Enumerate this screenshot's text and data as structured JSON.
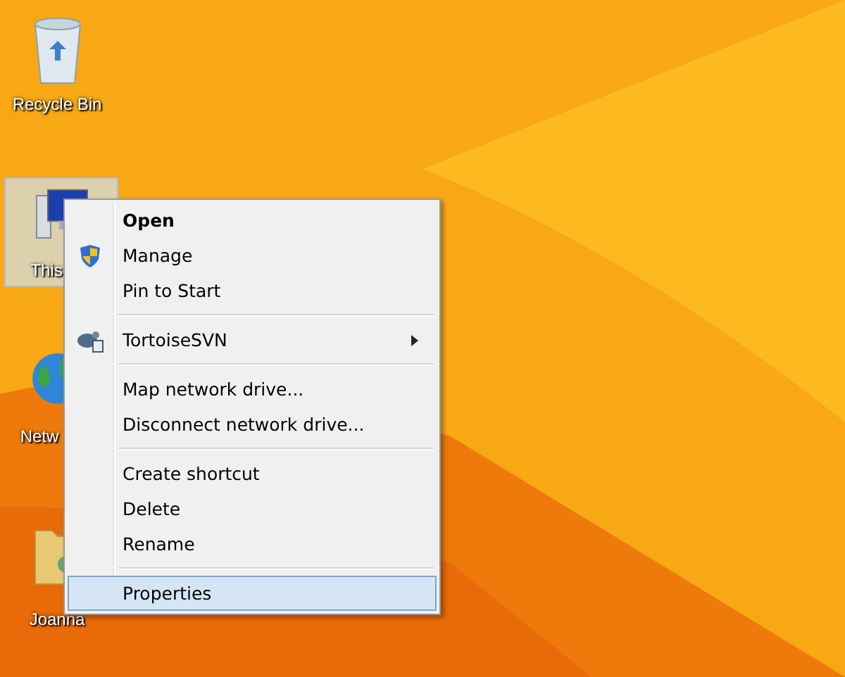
{
  "desktop_icons": [
    {
      "label": "Recycle Bin",
      "kind": "bin",
      "selected": false
    },
    {
      "label": "This",
      "kind": "computer",
      "selected": true
    },
    {
      "label": "Netw",
      "kind": "network",
      "selected": false
    },
    {
      "label": "Joanna",
      "kind": "userfolder",
      "selected": false
    }
  ],
  "context_menu": {
    "items": [
      {
        "kind": "item",
        "label": "Open",
        "default": true,
        "selected": false
      },
      {
        "kind": "item",
        "label": "Manage",
        "default": false,
        "selected": false
      },
      {
        "kind": "item",
        "label": "Pin to Start",
        "default": false,
        "selected": false
      },
      {
        "kind": "separator"
      },
      {
        "kind": "item",
        "label": "TortoiseSVN",
        "submenu": true,
        "default": false,
        "selected": false
      },
      {
        "kind": "separator"
      },
      {
        "kind": "item",
        "label": "Map network drive...",
        "default": false,
        "selected": false
      },
      {
        "kind": "item",
        "label": "Disconnect network drive...",
        "default": false,
        "selected": false
      },
      {
        "kind": "separator"
      },
      {
        "kind": "item",
        "label": "Create shortcut",
        "default": false,
        "selected": false
      },
      {
        "kind": "item",
        "label": "Delete",
        "default": false,
        "selected": false
      },
      {
        "kind": "item",
        "label": "Rename",
        "default": false,
        "selected": false
      },
      {
        "kind": "separator"
      },
      {
        "kind": "item",
        "label": "Properties",
        "default": false,
        "selected": true
      }
    ]
  }
}
